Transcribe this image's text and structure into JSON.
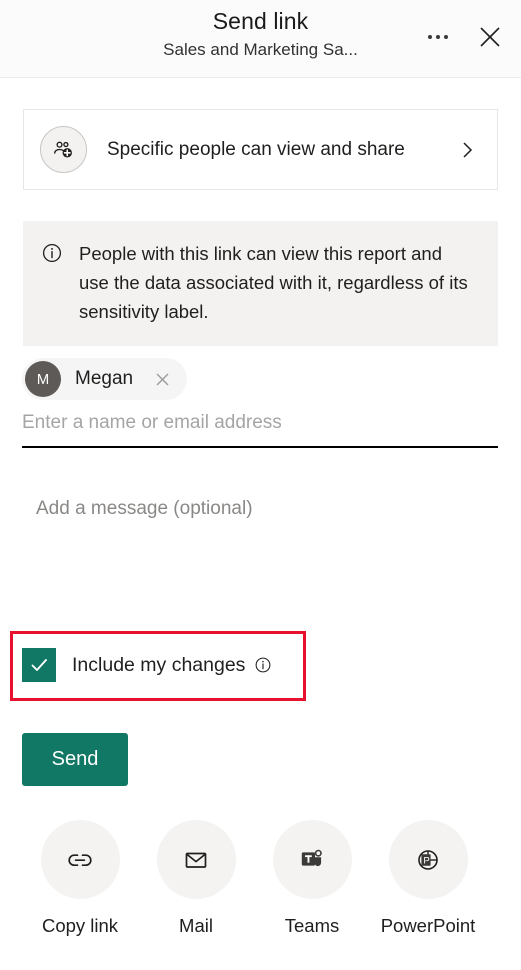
{
  "header": {
    "title": "Send link",
    "subtitle": "Sales and Marketing Sa...",
    "more_label": "More options",
    "close_label": "Close"
  },
  "permission": {
    "label": "Specific people can view and share",
    "icon": "people-add-icon",
    "chevron": "chevron-right-icon"
  },
  "info_banner": {
    "icon": "info-icon",
    "text": "People with this link can view this report and use the data associated with it, regardless of its sensitivity label."
  },
  "recipients": [
    {
      "initial": "M",
      "name": "Megan",
      "remove_label": "Remove"
    }
  ],
  "name_input": {
    "value": "",
    "placeholder": "Enter a name or email address"
  },
  "message_input": {
    "value": "",
    "placeholder": "Add a message (optional)"
  },
  "include_changes": {
    "label": "Include my changes",
    "checked": true,
    "info_icon": "info-icon",
    "highlight_color": "#e8112d",
    "accent_color": "#117865"
  },
  "send_button": {
    "label": "Send"
  },
  "share_targets": [
    {
      "label": "Copy link",
      "icon": "link-icon"
    },
    {
      "label": "Mail",
      "icon": "mail-icon"
    },
    {
      "label": "Teams",
      "icon": "teams-icon"
    },
    {
      "label": "PowerPoint",
      "icon": "powerpoint-icon"
    }
  ]
}
